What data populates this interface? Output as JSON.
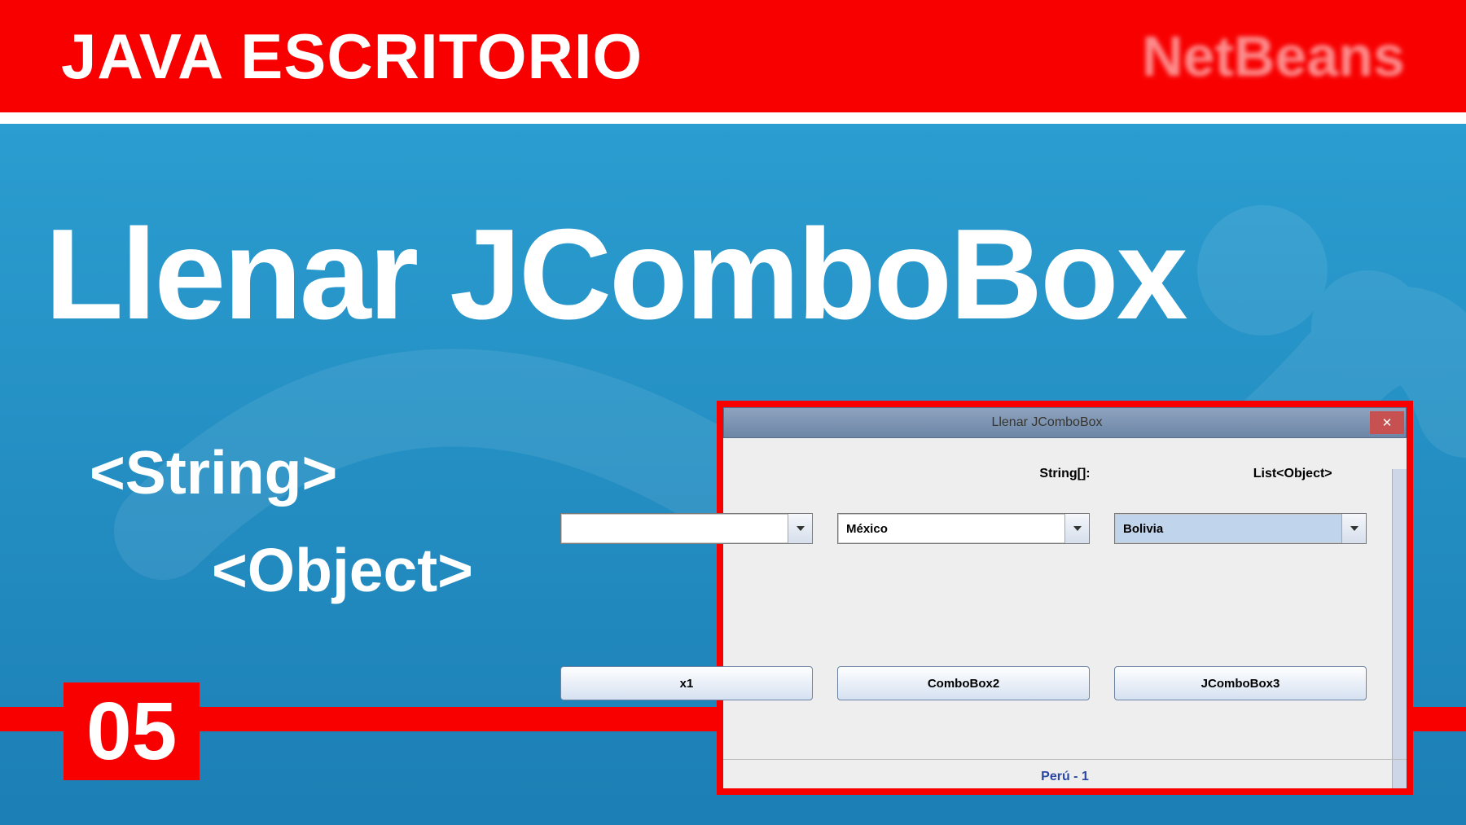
{
  "header": {
    "title": "JAVA ESCRITORIO",
    "right": "NetBeans"
  },
  "main": {
    "title": "Llenar JComboBox",
    "sub1": "<String>",
    "sub2": "<Object>",
    "episode": "05"
  },
  "window": {
    "title": "Llenar JComboBox",
    "labels": {
      "col2": "String[]:",
      "col3": "List<Object>"
    },
    "combo1_value": "",
    "combo2_value": "México",
    "combo3_value": "Bolivia",
    "btn1": "x1",
    "btn2": "ComboBox2",
    "btn3": "JComboBox3",
    "status": "Perú - 1"
  }
}
